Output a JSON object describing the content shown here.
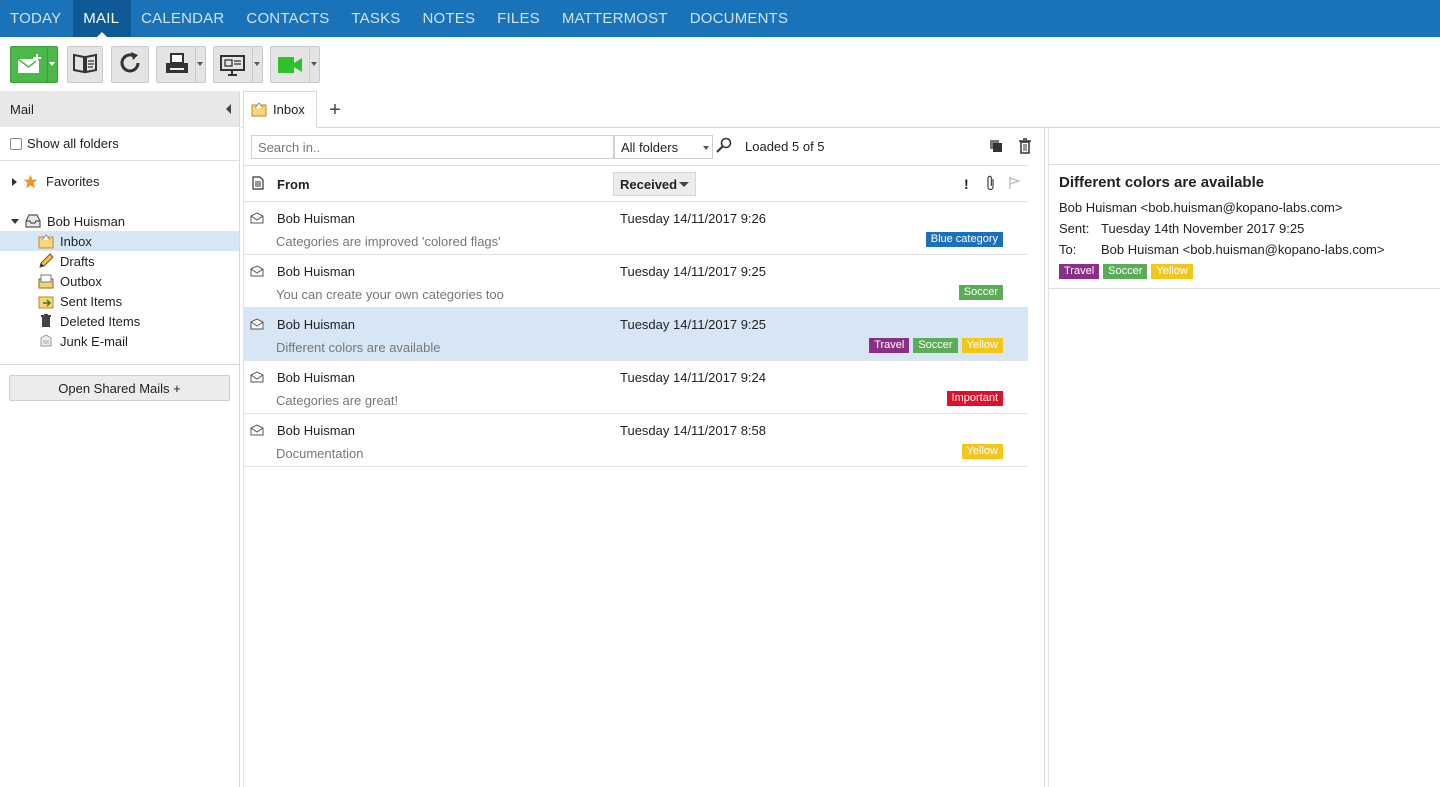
{
  "nav": {
    "tabs": [
      {
        "label": "TODAY"
      },
      {
        "label": "MAIL"
      },
      {
        "label": "CALENDAR"
      },
      {
        "label": "CONTACTS"
      },
      {
        "label": "TASKS"
      },
      {
        "label": "NOTES"
      },
      {
        "label": "FILES"
      },
      {
        "label": "MATTERMOST"
      },
      {
        "label": "DOCUMENTS"
      }
    ],
    "active": "MAIL"
  },
  "sidebar": {
    "title": "Mail",
    "show_all_folders": "Show all folders",
    "favorites": "Favorites",
    "store_owner": "Bob Huisman",
    "folders": [
      {
        "label": "Inbox",
        "icon": "inbox-folder-icon"
      },
      {
        "label": "Drafts",
        "icon": "pencil-icon"
      },
      {
        "label": "Outbox",
        "icon": "outbox-icon"
      },
      {
        "label": "Sent Items",
        "icon": "sent-items-icon"
      },
      {
        "label": "Deleted Items",
        "icon": "trash-icon"
      },
      {
        "label": "Junk E-mail",
        "icon": "junk-icon"
      }
    ],
    "shared_button": "Open Shared Mails +"
  },
  "tabs": {
    "open_tab": "Inbox",
    "add": "+"
  },
  "list": {
    "search_placeholder": "Search in..",
    "folder_filter": "All folders",
    "loaded": "Loaded 5 of 5",
    "col_from": "From",
    "col_received": "Received",
    "col_importance": "!",
    "messages": [
      {
        "from": "Bob Huisman",
        "date": "Tuesday 14/11/2017 9:26",
        "subject": "Categories are improved 'colored flags'",
        "categories": [
          {
            "label": "Blue category",
            "color": "#1c6fba"
          }
        ]
      },
      {
        "from": "Bob Huisman",
        "date": "Tuesday 14/11/2017 9:25",
        "subject": "You can create your own categories too",
        "categories": [
          {
            "label": "Soccer",
            "color": "#5aac56"
          }
        ]
      },
      {
        "from": "Bob Huisman",
        "date": "Tuesday 14/11/2017 9:25",
        "subject": "Different colors are available",
        "categories": [
          {
            "label": "Travel",
            "color": "#8b2f86"
          },
          {
            "label": "Soccer",
            "color": "#5aac56"
          },
          {
            "label": "Yellow",
            "color": "#f3c61b"
          }
        ]
      },
      {
        "from": "Bob Huisman",
        "date": "Tuesday 14/11/2017 9:24",
        "subject": "Categories are great!",
        "categories": [
          {
            "label": "Important",
            "color": "#e0102c"
          }
        ]
      },
      {
        "from": "Bob Huisman",
        "date": "Tuesday 14/11/2017 8:58",
        "subject": "Documentation",
        "categories": [
          {
            "label": "Yellow",
            "color": "#f3c61b"
          }
        ]
      }
    ],
    "selected_index": 2
  },
  "preview": {
    "subject": "Different colors are available",
    "from": "Bob Huisman <bob.huisman@kopano-labs.com>",
    "sent_label": "Sent:",
    "sent_value": "Tuesday 14th November 2017 9:25",
    "to_label": "To:",
    "to_value": "Bob Huisman <bob.huisman@kopano-labs.com>",
    "categories": [
      {
        "label": "Travel",
        "color": "#8b2f86"
      },
      {
        "label": "Soccer",
        "color": "#5aac56"
      },
      {
        "label": "Yellow",
        "color": "#f3c61b"
      }
    ]
  },
  "colors": {
    "nav_bg": "#1a73b8",
    "nav_active": "#0f5a96",
    "selection": "#d6e6f4"
  }
}
